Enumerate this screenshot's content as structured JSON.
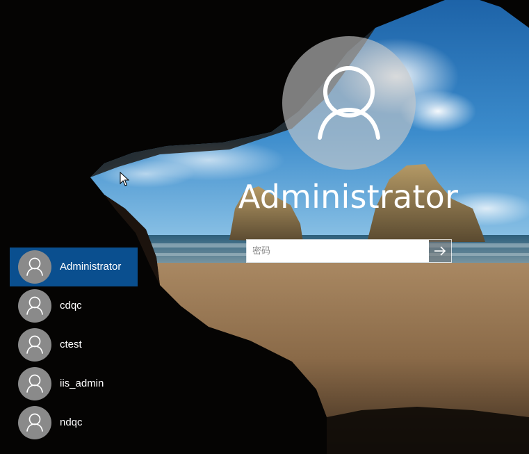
{
  "login": {
    "username": "Administrator",
    "password_placeholder": "密码"
  },
  "icons": {
    "avatar": "user-silhouette-icon",
    "submit": "arrow-right-icon",
    "cursor": "mouse-pointer-icon"
  },
  "users": [
    {
      "name": "Administrator",
      "selected": true
    },
    {
      "name": "cdqc",
      "selected": false
    },
    {
      "name": "ctest",
      "selected": false
    },
    {
      "name": "iis_admin",
      "selected": false
    },
    {
      "name": "ndqc",
      "selected": false
    }
  ],
  "colors": {
    "selected_user_bg": "#0a4f8f",
    "avatar_gray": "#8a8a8a"
  }
}
